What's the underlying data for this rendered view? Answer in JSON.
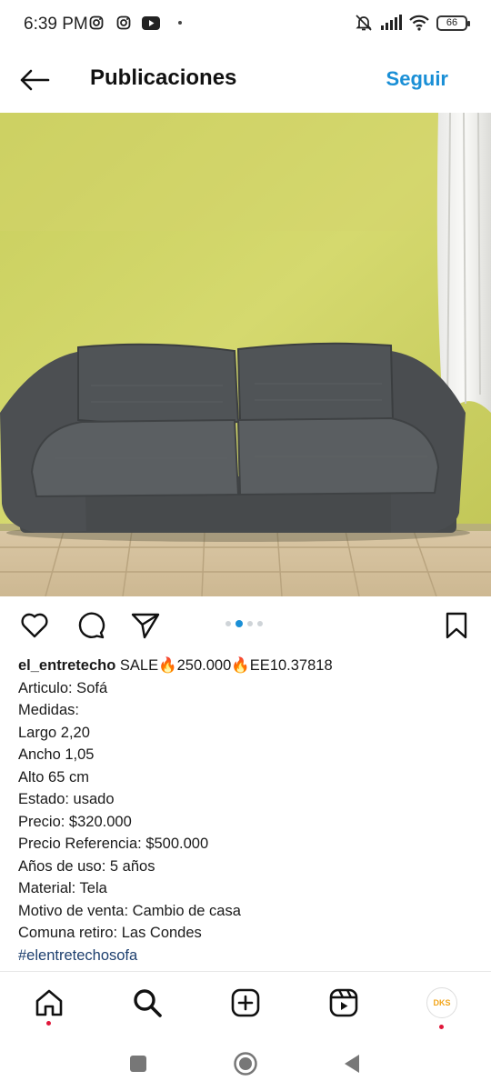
{
  "status_bar": {
    "time": "6:39 PM",
    "battery": "66",
    "left_icons": [
      "instagram-icon",
      "instagram-icon",
      "youtube-icon",
      "dot-icon"
    ],
    "right_icons": [
      "bell-muted-icon",
      "signal-icon",
      "wifi-icon",
      "battery-icon"
    ]
  },
  "header": {
    "title": "Publicaciones",
    "follow_label": "Seguir",
    "back_icon": "arrow-left-icon"
  },
  "post": {
    "image_alt_icon": "sofa-photo",
    "carousel": {
      "count": 4,
      "active_index": 1
    },
    "actions": [
      "heart-icon",
      "comment-icon",
      "share-icon",
      "bookmark-icon"
    ],
    "caption": {
      "username": "el_entretecho",
      "first_line": " SALE🔥250.000🔥EE10.37818",
      "lines": [
        "Articulo: Sofá",
        "Medidas:",
        "Largo 2,20",
        "Ancho 1,05",
        "Alto 65 cm",
        "Estado: usado",
        "Precio: $320.000",
        "Precio Referencia: $500.000",
        "Años de uso: 5 años",
        "Material: Tela",
        "Motivo de venta: Cambio de casa",
        "Comuna retiro: Las Condes"
      ],
      "hashtag": "#elentretechosofa"
    }
  },
  "bottom_nav": {
    "items": [
      "home-icon",
      "search-icon",
      "add-post-icon",
      "reels-icon",
      "profile-avatar"
    ],
    "avatar_text": "DKS"
  },
  "system_nav": [
    "recents-button",
    "home-button",
    "back-button"
  ],
  "colors": {
    "accent": "#1a8fd6",
    "hashtag": "#1d3f6e",
    "notification_dot": "#e0173a"
  }
}
